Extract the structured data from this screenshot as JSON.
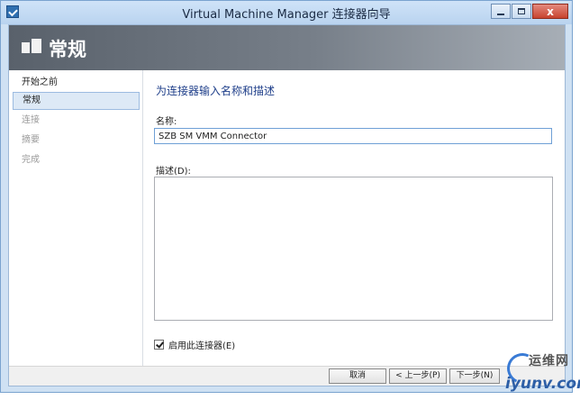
{
  "window": {
    "title": "Virtual Machine Manager 连接器向导",
    "minimize_glyph": "",
    "close_glyph": "x"
  },
  "banner": {
    "title": "常规",
    "icon": "wizard-page-icon"
  },
  "nav": {
    "items": [
      {
        "label": "开始之前",
        "state": "done"
      },
      {
        "label": "常规",
        "state": "active"
      },
      {
        "label": "连接",
        "state": "pending"
      },
      {
        "label": "摘要",
        "state": "pending"
      },
      {
        "label": "完成",
        "state": "pending"
      }
    ]
  },
  "main": {
    "heading": "为连接器输入名称和描述",
    "name_label": "名称:",
    "name_value": "SZB SM VMM Connector",
    "desc_label": "描述(D):",
    "desc_value": "",
    "enable_label": "启用此连接器(E)",
    "enable_checked": true
  },
  "footer": {
    "cancel": "取消",
    "prev": "< 上一步(P)",
    "next": "下一步(N)"
  },
  "watermark": {
    "brand": "运维网",
    "url": "iyunv.com"
  },
  "colors": {
    "heading": "#1f3f8a",
    "active_nav_bg": "#dde9f6",
    "banner_dark": "#59616b"
  }
}
